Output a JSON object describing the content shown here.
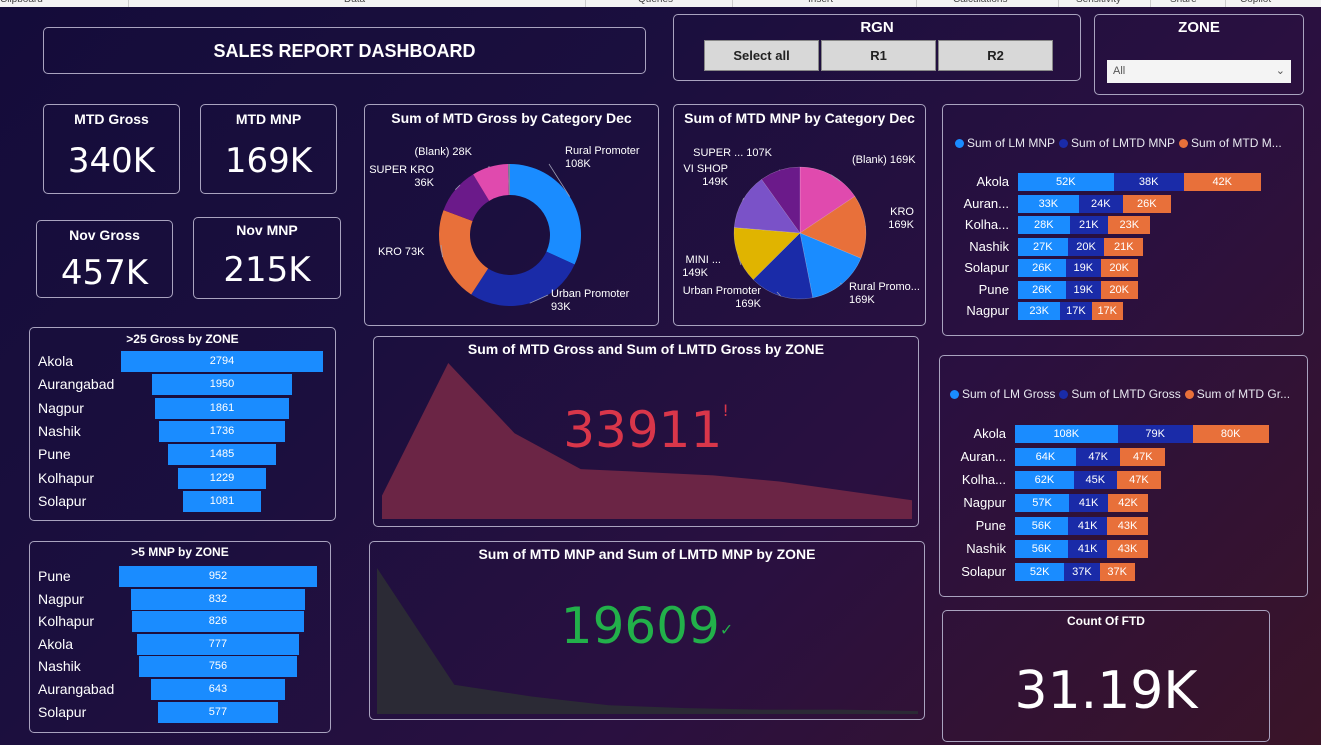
{
  "ribbon": [
    "Clipboard",
    "Data",
    "Queries",
    "Insert",
    "Calculations",
    "Sensitivity",
    "Share",
    "Copilot"
  ],
  "header": {
    "title": "SALES REPORT DASHBOARD"
  },
  "rgn": {
    "title": "RGN",
    "buttons": [
      "Select all",
      "R1",
      "R2"
    ]
  },
  "zone": {
    "title": "ZONE",
    "select_value": "All"
  },
  "kpis": [
    {
      "title": "MTD Gross",
      "value": "340K"
    },
    {
      "title": "MTD MNP",
      "value": "169K"
    },
    {
      "title": "Nov Gross",
      "value": "457K"
    },
    {
      "title": "Nov MNP",
      "value": "215K"
    }
  ],
  "colors": {
    "blue": "#1a8cff",
    "navy": "#1a2ba8",
    "orange": "#e8703a",
    "red": "#d9364a",
    "green": "#22b04a"
  },
  "chart_data": [
    {
      "id": "donut",
      "type": "pie",
      "title": "Sum of MTD Gross by Category Dec",
      "slices": [
        {
          "label": "Rural Promoter",
          "value": 108,
          "display": "108K",
          "color": "#1a8cff"
        },
        {
          "label": "Urban Promoter",
          "value": 93,
          "display": "93K",
          "color": "#1a2ba8"
        },
        {
          "label": "KRO",
          "value": 73,
          "display": "73K",
          "color": "#e8703a"
        },
        {
          "label": "SUPER KRO",
          "value": 36,
          "display": "36K",
          "color": "#6b1a8a"
        },
        {
          "label": "(Blank)",
          "value": 28,
          "display": "28K",
          "color": "#e04aae"
        },
        {
          "label": "",
          "value": 1.5,
          "display": "",
          "color": "#7a8aa0"
        }
      ]
    },
    {
      "id": "pie",
      "type": "pie",
      "title": "Sum of MTD MNP by Category Dec",
      "slices": [
        {
          "label": "(Blank)",
          "value": 169,
          "display": "169K",
          "color": "#e04aae"
        },
        {
          "label": "KRO",
          "value": 169,
          "display": "169K",
          "color": "#e8703a"
        },
        {
          "label": "Rural Promo...",
          "value": 169,
          "display": "169K",
          "color": "#1a8cff"
        },
        {
          "label": "Urban Promoter",
          "value": 169,
          "display": "169K",
          "color": "#1a2ba8"
        },
        {
          "label": "MINI ...",
          "value": 149,
          "display": "149K",
          "color": "#e0b400"
        },
        {
          "label": "VI SHOP",
          "value": 149,
          "display": "149K",
          "color": "#7a52c8"
        },
        {
          "label": "SUPER ...",
          "value": 107,
          "display": "107K",
          "color": "#6b1a8a"
        }
      ]
    },
    {
      "id": "mnp_zone",
      "type": "bar",
      "series": [
        {
          "name": "Sum of LM MNP",
          "color": "#1a8cff",
          "values": [
            52,
            33,
            28,
            27,
            26,
            26,
            23
          ]
        },
        {
          "name": "Sum of LMTD MNP",
          "color": "#1a2ba8",
          "values": [
            38,
            24,
            21,
            20,
            19,
            19,
            17
          ]
        },
        {
          "name": "Sum of MTD M...",
          "color": "#e8703a",
          "values": [
            42,
            26,
            23,
            21,
            20,
            20,
            17
          ]
        }
      ],
      "categories": [
        "Akola",
        "Auran...",
        "Kolha...",
        "Nashik",
        "Solapur",
        "Pune",
        "Nagpur"
      ],
      "value_suffix": "K"
    },
    {
      "id": "gross_zone",
      "type": "bar",
      "series": [
        {
          "name": "Sum of LM Gross",
          "color": "#1a8cff",
          "values": [
            108,
            64,
            62,
            57,
            56,
            56,
            52
          ]
        },
        {
          "name": "Sum of LMTD Gross",
          "color": "#1a2ba8",
          "values": [
            79,
            47,
            45,
            41,
            41,
            41,
            37
          ]
        },
        {
          "name": "Sum of MTD Gr...",
          "color": "#e8703a",
          "values": [
            80,
            47,
            47,
            42,
            43,
            43,
            37
          ]
        }
      ],
      "categories": [
        "Akola",
        "Auran...",
        "Kolha...",
        "Nagpur",
        "Pune",
        "Nashik",
        "Solapur"
      ],
      "value_suffix": "K"
    },
    {
      "id": "funnel25",
      "type": "bar",
      "title": ">25 Gross by ZONE",
      "categories": [
        "Akola",
        "Aurangabad",
        "Nagpur",
        "Nashik",
        "Pune",
        "Kolhapur",
        "Solapur"
      ],
      "values": [
        2794,
        1950,
        1861,
        1736,
        1485,
        1229,
        1081
      ]
    },
    {
      "id": "funnel5",
      "type": "bar",
      "title": ">5 MNP by ZONE",
      "categories": [
        "Pune",
        "Nagpur",
        "Kolhapur",
        "Akola",
        "Nashik",
        "Aurangabad",
        "Solapur"
      ],
      "values": [
        952,
        832,
        826,
        777,
        756,
        643,
        577
      ]
    },
    {
      "id": "area_gross",
      "type": "area",
      "title": "Sum of MTD Gross and Sum of LMTD Gross by ZONE",
      "kpi_value": "33911",
      "kpi_indicator": "!",
      "values": [
        0.15,
        1.0,
        0.55,
        0.32,
        0.3,
        0.28,
        0.24,
        0.18,
        0.12
      ]
    },
    {
      "id": "area_mnp",
      "type": "area",
      "title": "Sum of MTD MNP and Sum of LMTD MNP by ZONE",
      "kpi_value": "19609",
      "kpi_indicator": "✓",
      "values": [
        1.0,
        0.2,
        0.12,
        0.06,
        0.04,
        0.03,
        0.03,
        0.02
      ]
    }
  ],
  "ftd": {
    "title": "Count Of FTD",
    "value": "31.19K"
  }
}
